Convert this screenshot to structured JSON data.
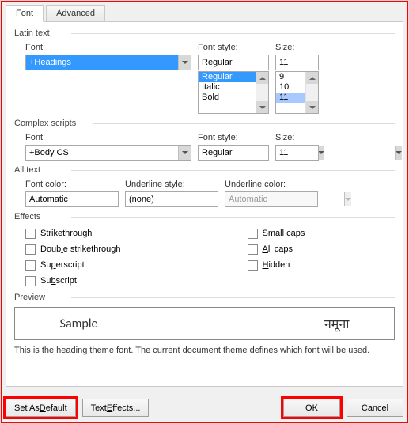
{
  "tabs": {
    "font": "Font",
    "advanced": "Advanced"
  },
  "latin": {
    "group": "Latin text",
    "font_label": "Font:",
    "font_value": "+Headings",
    "style_label": "Font style:",
    "style_value": "Regular",
    "style_options": [
      "Regular",
      "Italic",
      "Bold"
    ],
    "size_label": "Size:",
    "size_value": "11",
    "size_options": [
      "9",
      "10",
      "11"
    ]
  },
  "complex": {
    "group": "Complex scripts",
    "font_label": "Font:",
    "font_value": "+Body CS",
    "style_label": "Font style:",
    "style_value": "Regular",
    "size_label": "Size:",
    "size_value": "11"
  },
  "alltext": {
    "group": "All text",
    "color_label": "Font color:",
    "color_value": "Automatic",
    "underline_label": "Underline style:",
    "underline_value": "(none)",
    "ucolor_label": "Underline color:",
    "ucolor_value": "Automatic"
  },
  "effects": {
    "group": "Effects",
    "left": [
      "Strikethrough",
      "Double strikethrough",
      "Superscript",
      "Subscript"
    ],
    "right": [
      "Small caps",
      "All caps",
      "Hidden"
    ]
  },
  "preview": {
    "group": "Preview",
    "sample1": "Sample",
    "sample2": "नमूना",
    "desc": "This is the heading theme font. The current document theme defines which font will be used."
  },
  "buttons": {
    "default": "Set As Default",
    "text_effects": "Text Effects...",
    "ok": "OK",
    "cancel": "Cancel"
  }
}
